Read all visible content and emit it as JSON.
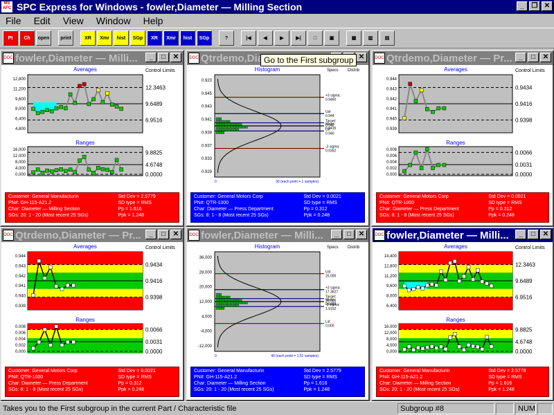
{
  "app": {
    "title": "SPC Express for Windows - fowler,Diameter — Milling Section",
    "icon_text": "MS AFC"
  },
  "menu": [
    "File",
    "Edit",
    "View",
    "Window",
    "Help"
  ],
  "toolbar": [
    {
      "label": "Pt",
      "c": "r"
    },
    {
      "label": "Ch",
      "c": "r"
    },
    {
      "label": "open",
      "c": ""
    },
    {
      "sep": 1
    },
    {
      "label": "print",
      "c": ""
    },
    {
      "sep": 1
    },
    {
      "label": "XR",
      "c": "y"
    },
    {
      "label": "Xmr",
      "c": "y"
    },
    {
      "label": "hist",
      "c": "y"
    },
    {
      "label": "SGp",
      "c": "y"
    },
    {
      "label": "XR",
      "c": "b"
    },
    {
      "label": "Xmr",
      "c": "b"
    },
    {
      "label": "hist",
      "c": "b"
    },
    {
      "label": "SGp",
      "c": "b"
    },
    {
      "sep": 1
    },
    {
      "label": "?",
      "c": ""
    },
    {
      "sep": 1
    },
    {
      "label": "|◀",
      "c": ""
    },
    {
      "label": "◀",
      "c": ""
    },
    {
      "label": "▶",
      "c": ""
    },
    {
      "label": "▶|",
      "c": ""
    },
    {
      "label": "□",
      "c": ""
    },
    {
      "label": "▣",
      "c": ""
    },
    {
      "sep": 1
    },
    {
      "label": "▦",
      "c": ""
    },
    {
      "label": "▥",
      "c": ""
    },
    {
      "label": "▤",
      "c": ""
    }
  ],
  "tooltip": "Go to the First subgroup",
  "status": {
    "text": "Takes you to the First subgroup in the current Part / Characteristic file",
    "subgroup": "Subgroup #8",
    "num": "NUM"
  },
  "labels": {
    "averages": "Averages",
    "ranges": "Ranges",
    "histogram": "Histogram",
    "control_limits": "Control Limits",
    "specs": "Specs",
    "distrib": "Distrib"
  },
  "windows": [
    {
      "id": "w1",
      "title": "fowler,Diameter — Milli...",
      "active": false,
      "kind": "xbar",
      "shaded": false,
      "color": "red",
      "avg_ticks": [
        "12,800",
        "11,200",
        "9,600",
        "8,000",
        "6,400",
        "4,800"
      ],
      "avg_limits": [
        "12.3463",
        "9.6489",
        "6.9516"
      ],
      "rng_ticks": [
        "16,000",
        "12,000",
        "8,000",
        "4,000",
        "0,000"
      ],
      "rng_limits": [
        "9.8825",
        "4.6748",
        "0.0000"
      ],
      "info": {
        "l": [
          "Customer: General Manufacturin",
          "PN#: GH-115-A21.2",
          "Char: Diameter — Milling Section",
          "SGs: 20: 1 - 20 (Most recent 25 SGs)"
        ],
        "r": [
          "Std Dev = 2.5779",
          "SD type = RMS",
          "Pp = 1.616",
          "Ppk = 1.248"
        ]
      }
    },
    {
      "id": "w2",
      "title": "Qtrdemo,Dia",
      "active": false,
      "kind": "hist",
      "color": "blue",
      "ticks": [
        "0.923",
        "0.945",
        "0.943",
        "0.941",
        "0.939",
        "0.937",
        "0.933",
        "0.929"
      ],
      "spec": [
        "+3 sigma: 0.9460",
        "Usl: 0.944",
        "Target: 0.942",
        "Mean: 0.9415",
        "Lsl: 0.940",
        "-3 sigma: 0.9352"
      ],
      "foot": "30 (each point = 1 samples)",
      "info": {
        "l": [
          "Customer: General Motors Corp",
          "PN#: QTR-1000",
          "Char: Diameter — Press Department",
          "SGs: 8: 1 - 8 (Most recent 25 SGs)"
        ],
        "r": [
          "Std Dev = 0.0021",
          "SD type = RMS",
          "Pp = 0.312",
          "Ppk = 0.248"
        ]
      }
    },
    {
      "id": "w3",
      "title": "Qtrdemo,Diameter — Pr...",
      "active": false,
      "kind": "xbar",
      "shaded": false,
      "color": "red",
      "avg_ticks": [
        "0.944",
        "0.943",
        "0.942",
        "0.941",
        "0.940",
        "0.939"
      ],
      "avg_limits": [
        "0.9434",
        "0.9416",
        "0.9398"
      ],
      "rng_ticks": [
        "0.008",
        "0.006",
        "0.004",
        "0.002",
        "0.000"
      ],
      "rng_limits": [
        "0.0066",
        "0.0031",
        "0.0000"
      ],
      "info": {
        "l": [
          "Customer: General Motors Corp",
          "PN#: QTR-1000",
          "Char: Diameter — Press Department",
          "SGs: 8: 1 - 8 (Most recent 25 SGs)"
        ],
        "r": [
          "Std Dev = 0.0021",
          "SD type = RMS",
          "Pp = 0.312",
          "Ppk = 0.248"
        ]
      }
    },
    {
      "id": "w4",
      "title": "Qtrdemo,Diameter — Pr...",
      "active": false,
      "kind": "xbar",
      "shaded": true,
      "color": "red",
      "avg_ticks": [
        "0.944",
        "0.943",
        "0.942",
        "0.941",
        "0.940",
        "0.939"
      ],
      "avg_limits": [
        "0.9434",
        "0.9416",
        "0.9398"
      ],
      "rng_ticks": [
        "0.008",
        "0.006",
        "0.004",
        "0.002",
        "0.000"
      ],
      "rng_limits": [
        "0.0066",
        "0.0031",
        "0.0000"
      ],
      "info": {
        "l": [
          "Customer: General Motors Corp",
          "PN#: QTR-1000",
          "Char: Diameter — Press Department",
          "SGs: 8: 1 - 8 (Most recent 25 SGs)"
        ],
        "r": [
          "Std Dev = 0.0021",
          "SD type = RMS",
          "Pp = 0.312",
          "Ppk = 0.248"
        ]
      }
    },
    {
      "id": "w5",
      "title": "fowler,Diameter — Milli...",
      "active": false,
      "kind": "hist",
      "color": "blue",
      "ticks": [
        "36,000",
        "28,000",
        "20,000",
        "12,000",
        "4,000",
        "-4,000",
        "-12,000"
      ],
      "spec": [
        "Usl: 25.000",
        "+3 sigma: 17.3627",
        "Target: 10.000",
        "Mean: 9.6489",
        "-3 sigma: 1.9152",
        "Lsl: 0.000"
      ],
      "foot": "40 (each point = 1.51 samples)",
      "info": {
        "l": [
          "Customer: General Manufacturin",
          "PN#: GH-115-A21.2",
          "Char: Diameter — Milling Section",
          "SGs: 20: 1 - 20 (Most recent 25 SGs)"
        ],
        "r": [
          "Std Dev = 2.5779",
          "SD type = RMS",
          "Pp = 1.616",
          "Ppk = 1.248"
        ]
      }
    },
    {
      "id": "w6",
      "title": "fowler,Diameter — Milli...",
      "active": true,
      "kind": "xbar",
      "shaded": true,
      "color": "red",
      "avg_ticks": [
        "14,400",
        "12,800",
        "11,200",
        "9,600",
        "8,000",
        "6,400"
      ],
      "avg_limits": [
        "12.3463",
        "9.6489",
        "6.9516"
      ],
      "rng_ticks": [
        "16,000",
        "12,000",
        "8,000",
        "4,000",
        "0,000"
      ],
      "rng_limits": [
        "9.8825",
        "4.6748",
        "0.0000"
      ],
      "info": {
        "l": [
          "Customer: General Manufacturin",
          "PN#: GH-115-A21.2",
          "Char: Diameter — Milling Section",
          "SGs: 20: 1 - 20 (Most recent 25 SGs)"
        ],
        "r": [
          "Std Dev = 2.5779",
          "SD type = RMS",
          "Pp = 1.616",
          "Ppk = 1.248"
        ]
      }
    }
  ],
  "series": {
    "fowler_avg": [
      8.8,
      8.1,
      8.3,
      8.6,
      8.4,
      8.9,
      9.1,
      8.9,
      11.2,
      9.8,
      12.6,
      12.9,
      9.6,
      10.4,
      11.9,
      9.9,
      11.4,
      9.5,
      9.2,
      8.8
    ],
    "fowler_rng": [
      1.2,
      3.1,
      1.0,
      2.4,
      1.8,
      2.6,
      3.2,
      2.1,
      3.0,
      1.5,
      8.8,
      11.2,
      3.0,
      1.0,
      4.1,
      3.3,
      2.9,
      1.4,
      9.2,
      3.1
    ],
    "qtr_avg": [
      0.94,
      0.9438,
      0.9419,
      0.9431,
      0.941,
      0.9407,
      0.9411,
      0.9411
    ],
    "qtr_rng": [
      0.001,
      0.003,
      0.007,
      0.002,
      0.008,
      0.002,
      0.003,
      0.003
    ]
  }
}
